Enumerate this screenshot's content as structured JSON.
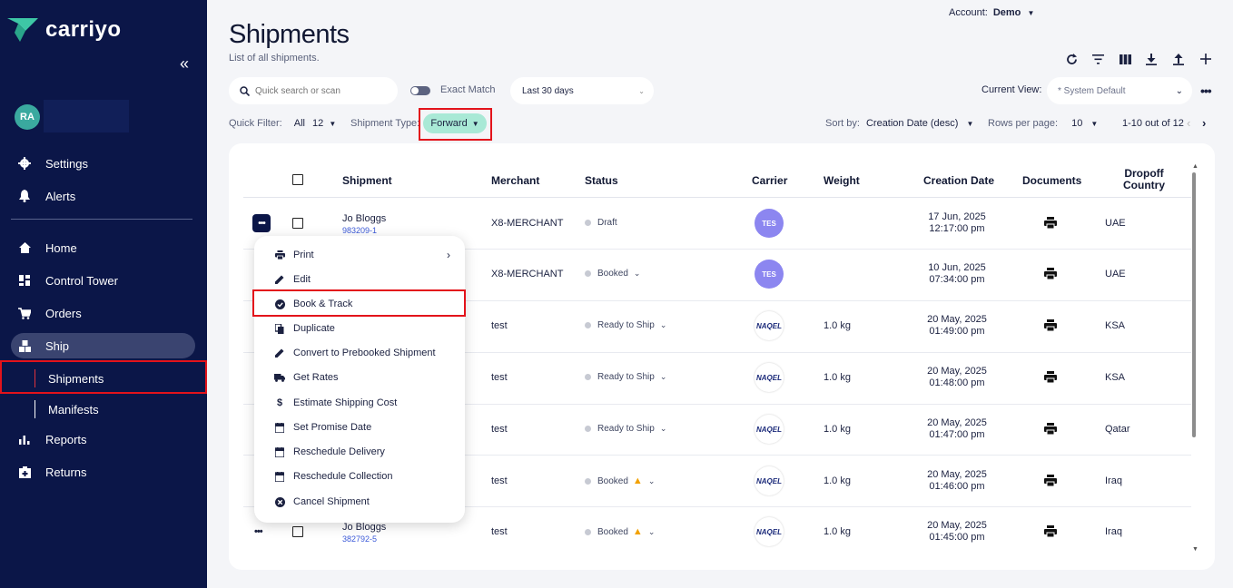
{
  "brand": {
    "name": "carriyo",
    "color": "#3ec7a6"
  },
  "sidebar": {
    "collapse_icon": "double-chevron-left-icon",
    "user": {
      "initials": "RA"
    },
    "items": [
      {
        "label": "Settings",
        "icon": "gear-icon"
      },
      {
        "label": "Alerts",
        "icon": "bell-icon"
      },
      {
        "label": "Home",
        "icon": "home-icon"
      },
      {
        "label": "Control Tower",
        "icon": "dashboard-icon"
      },
      {
        "label": "Orders",
        "icon": "cart-icon"
      },
      {
        "label": "Ship",
        "icon": "ship-icon"
      },
      {
        "label": "Reports",
        "icon": "bar-chart-icon"
      },
      {
        "label": "Returns",
        "icon": "return-box-icon"
      }
    ],
    "sub_items": [
      {
        "label": "Shipments",
        "selected": true
      },
      {
        "label": "Manifests",
        "selected": false
      }
    ]
  },
  "header": {
    "account_label": "Account:",
    "account_value": "Demo",
    "title": "Shipments",
    "subtitle": "List of all shipments.",
    "toolbar_icons": [
      "refresh-icon",
      "filter-icon",
      "columns-icon",
      "download-icon",
      "upload-icon",
      "plus-icon"
    ]
  },
  "filters": {
    "search_placeholder": "Quick search or scan",
    "exact_match_label": "Exact Match",
    "exact_match_on": false,
    "date_range": "Last 30 days",
    "current_view_label": "Current View:",
    "current_view_value": "* System Default",
    "quick_filter_label": "Quick Filter:",
    "quick_filter_value": "All",
    "quick_filter_count": "12",
    "shipment_type_label": "Shipment Type:",
    "shipment_type_value": "Forward",
    "sort_label": "Sort by:",
    "sort_value": "Creation Date (desc)",
    "rows_label": "Rows per page:",
    "rows_value": "10",
    "pagination": "1-10 out of 12"
  },
  "table": {
    "columns": [
      "Shipment",
      "Merchant",
      "Status",
      "Carrier",
      "Weight",
      "Creation Date",
      "Documents",
      "Dropoff Country"
    ],
    "rows": [
      {
        "name": "Jo Bloggs",
        "id": "983209-1",
        "merchant": "X8-MERCHANT",
        "status": "Draft",
        "status_dropdown": false,
        "warning": false,
        "carrier": "TES",
        "weight": "",
        "date": "17 Jun, 2025",
        "time": "12:17:00 pm",
        "country": "UAE"
      },
      {
        "name": "",
        "id": "",
        "merchant": "X8-MERCHANT",
        "status": "Booked",
        "status_dropdown": true,
        "warning": false,
        "carrier": "TES",
        "weight": "",
        "date": "10 Jun, 2025",
        "time": "07:34:00 pm",
        "country": "UAE"
      },
      {
        "name": "",
        "id": "",
        "merchant": "test",
        "status": "Ready to Ship",
        "status_dropdown": true,
        "warning": false,
        "carrier": "NAQEL",
        "weight": "1.0 kg",
        "date": "20 May, 2025",
        "time": "01:49:00 pm",
        "country": "KSA"
      },
      {
        "name": "",
        "id": "",
        "merchant": "test",
        "status": "Ready to Ship",
        "status_dropdown": true,
        "warning": false,
        "carrier": "NAQEL",
        "weight": "1.0 kg",
        "date": "20 May, 2025",
        "time": "01:48:00 pm",
        "country": "KSA"
      },
      {
        "name": "",
        "id": "",
        "merchant": "test",
        "status": "Ready to Ship",
        "status_dropdown": true,
        "warning": false,
        "carrier": "NAQEL",
        "weight": "1.0 kg",
        "date": "20 May, 2025",
        "time": "01:47:00 pm",
        "country": "Qatar"
      },
      {
        "name": "",
        "id": "",
        "merchant": "test",
        "status": "Booked",
        "status_dropdown": true,
        "warning": true,
        "carrier": "NAQEL",
        "weight": "1.0 kg",
        "date": "20 May, 2025",
        "time": "01:46:00 pm",
        "country": "Iraq"
      },
      {
        "name": "Jo Bloggs",
        "id": "382792-5",
        "merchant": "test",
        "status": "Booked",
        "status_dropdown": true,
        "warning": true,
        "carrier": "NAQEL",
        "weight": "1.0 kg",
        "date": "20 May, 2025",
        "time": "01:45:00 pm",
        "country": "Iraq"
      }
    ]
  },
  "context_menu": {
    "items": [
      {
        "label": "Print",
        "icon": "printer-icon",
        "submenu": true
      },
      {
        "label": "Edit",
        "icon": "pencil-icon"
      },
      {
        "label": "Book & Track",
        "icon": "check-circle-icon",
        "highlighted": true
      },
      {
        "label": "Duplicate",
        "icon": "copy-icon"
      },
      {
        "label": "Convert to Prebooked Shipment",
        "icon": "pencil-icon"
      },
      {
        "label": "Get Rates",
        "icon": "truck-icon"
      },
      {
        "label": "Estimate Shipping Cost",
        "icon": "dollar-icon"
      },
      {
        "label": "Set Promise Date",
        "icon": "calendar-icon"
      },
      {
        "label": "Reschedule Delivery",
        "icon": "calendar-icon"
      },
      {
        "label": "Reschedule Collection",
        "icon": "calendar-icon"
      },
      {
        "label": "Cancel Shipment",
        "icon": "cancel-circle-icon"
      }
    ]
  },
  "colors": {
    "sidebar_bg": "#0b1648",
    "chip_bg": "#a9e9d6",
    "highlight_border": "#e3131b",
    "tes_badge": "#8c86f0"
  }
}
